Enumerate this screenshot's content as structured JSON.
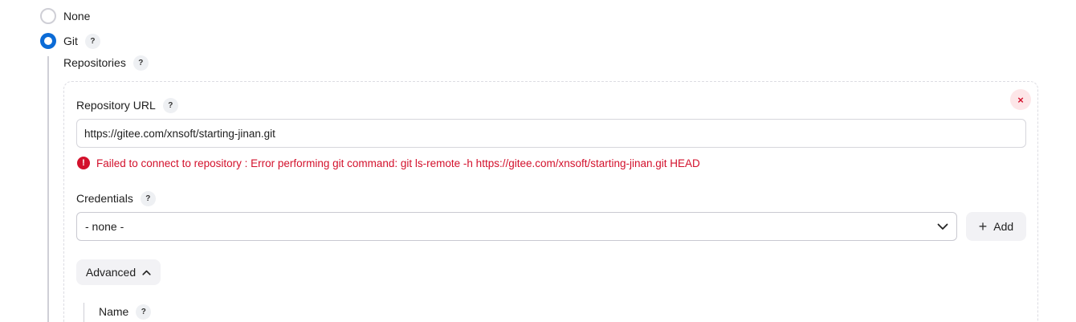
{
  "scm_options": [
    {
      "label": "None",
      "selected": false
    },
    {
      "label": "Git",
      "selected": true
    }
  ],
  "help_glyph": "?",
  "repositories": {
    "label": "Repositories",
    "remove_glyph": "×",
    "repository_url": {
      "label": "Repository URL",
      "value": "https://gitee.com/xnsoft/starting-jinan.git"
    },
    "error": {
      "icon_glyph": "!",
      "message": "Failed to connect to repository : Error performing git command: git ls-remote -h https://gitee.com/xnsoft/starting-jinan.git HEAD"
    },
    "credentials": {
      "label": "Credentials",
      "selected": "- none -",
      "add_label": "Add",
      "add_glyph": "+"
    },
    "advanced": {
      "label": "Advanced",
      "expanded": true,
      "name_label": "Name"
    }
  },
  "colors": {
    "accent": "#0b6bd6",
    "error": "#d3112c",
    "border": "#c9c9d1"
  }
}
